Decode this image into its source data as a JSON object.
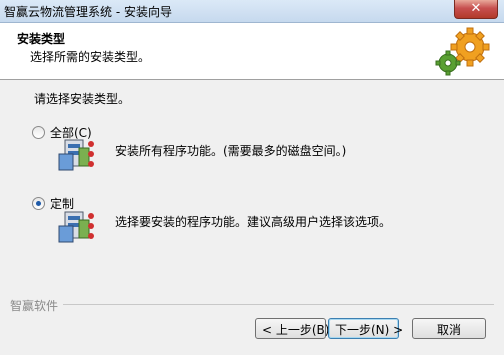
{
  "window": {
    "title": "智赢云物流管理系统 - 安装向导",
    "close_symbol": "✕"
  },
  "header": {
    "title": "安装类型",
    "subtitle": "选择所需的安装类型。"
  },
  "prompt": "请选择安装类型。",
  "options": [
    {
      "label": "全部(C)",
      "description": "安装所有程序功能。(需要最多的磁盘空间。)",
      "selected": false
    },
    {
      "label": "定制",
      "description": "选择要安装的程序功能。建议高级用户选择该选项。",
      "selected": true
    }
  ],
  "brand": "智赢软件",
  "buttons": {
    "back": "< 上一步(B)",
    "next": "下一步(N) >",
    "cancel": "取消"
  },
  "colors": {
    "radio_dot": "#1e5aa8",
    "close_button": "#c75050",
    "gear_orange": "#f0a020",
    "gear_green": "#5aa032"
  }
}
